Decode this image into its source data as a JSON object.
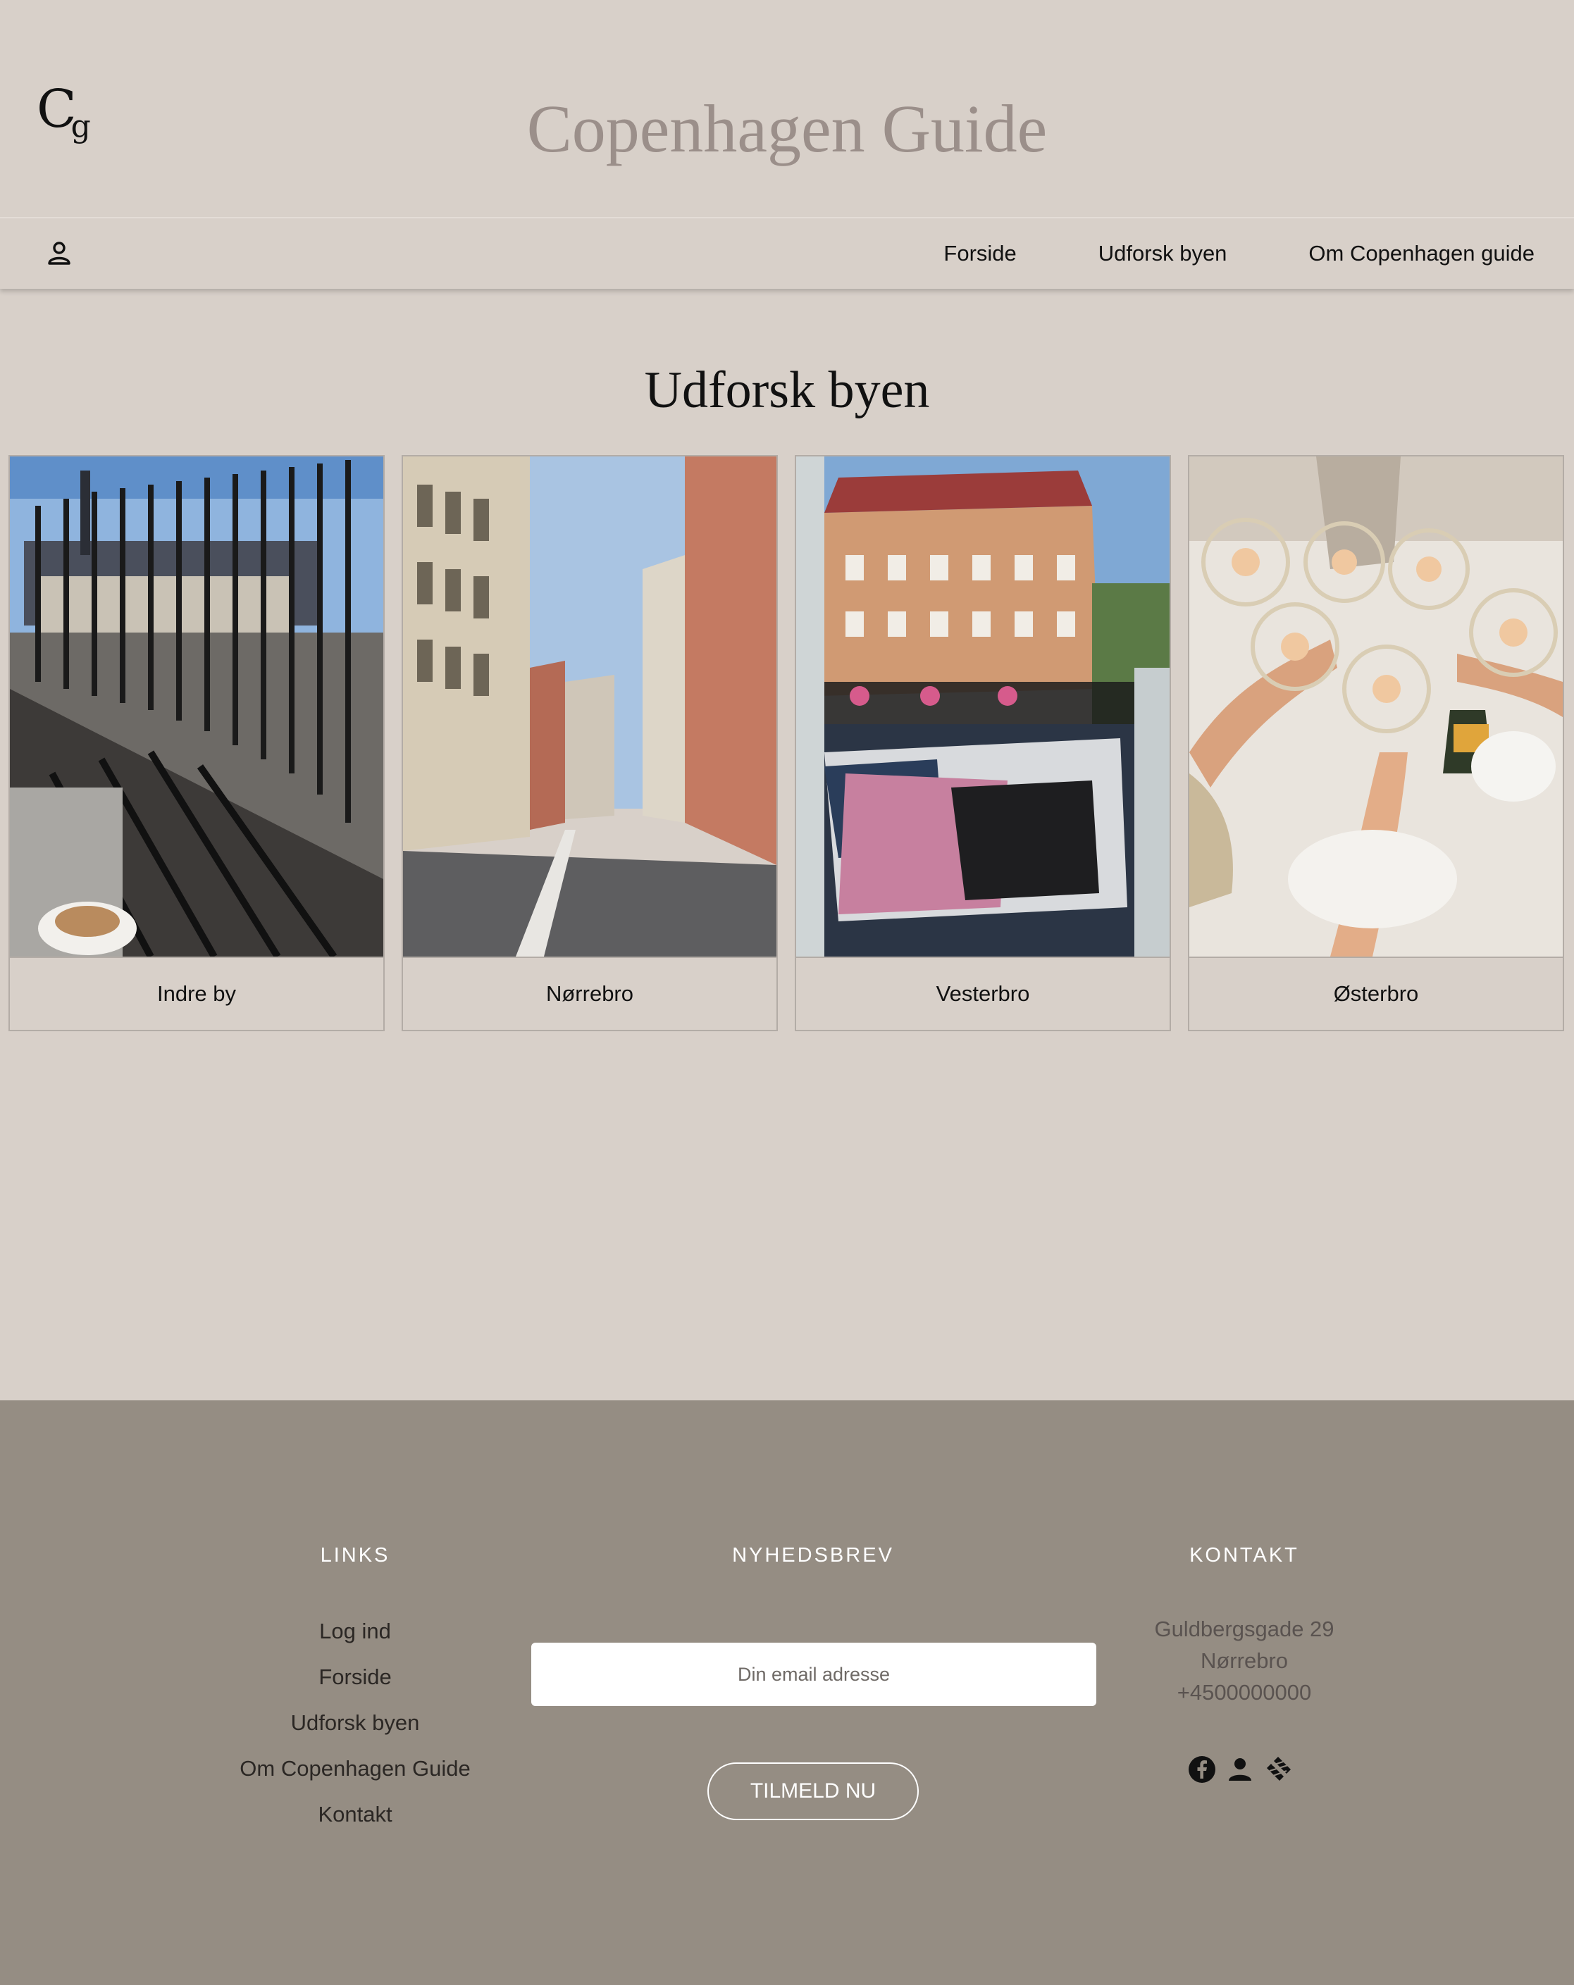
{
  "header": {
    "logo_text": "Cg",
    "site_title": "Copenhagen Guide",
    "nav": [
      "Forside",
      "Udforsk byen",
      "Om Copenhagen guide"
    ]
  },
  "main": {
    "heading": "Udforsk byen",
    "cards": [
      {
        "label": "Indre by",
        "icon": "balcony-photo"
      },
      {
        "label": "Nørrebro",
        "icon": "street-photo"
      },
      {
        "label": "Vesterbro",
        "icon": "bed-balcony-photo"
      },
      {
        "label": "Østerbro",
        "icon": "dinner-table-photo"
      }
    ]
  },
  "footer": {
    "links": {
      "title": "LINKS",
      "items": [
        "Log ind",
        "Forside",
        "Udforsk byen",
        "Om Copenhagen Guide",
        "Kontakt"
      ]
    },
    "newsletter": {
      "title": "NYHEDSBREV",
      "placeholder": "Din email adresse",
      "button": "TILMELD NU"
    },
    "contact": {
      "title": "KONTAKT",
      "address": "Guldbergsgade 29",
      "area": "Nørrebro",
      "phone": "+4500000000",
      "socials": [
        "facebook-icon",
        "person-icon",
        "brand-icon"
      ]
    }
  },
  "colors": {
    "background": "#d8d0c9",
    "footer": "#958d83",
    "title": "#9b8f8a"
  }
}
